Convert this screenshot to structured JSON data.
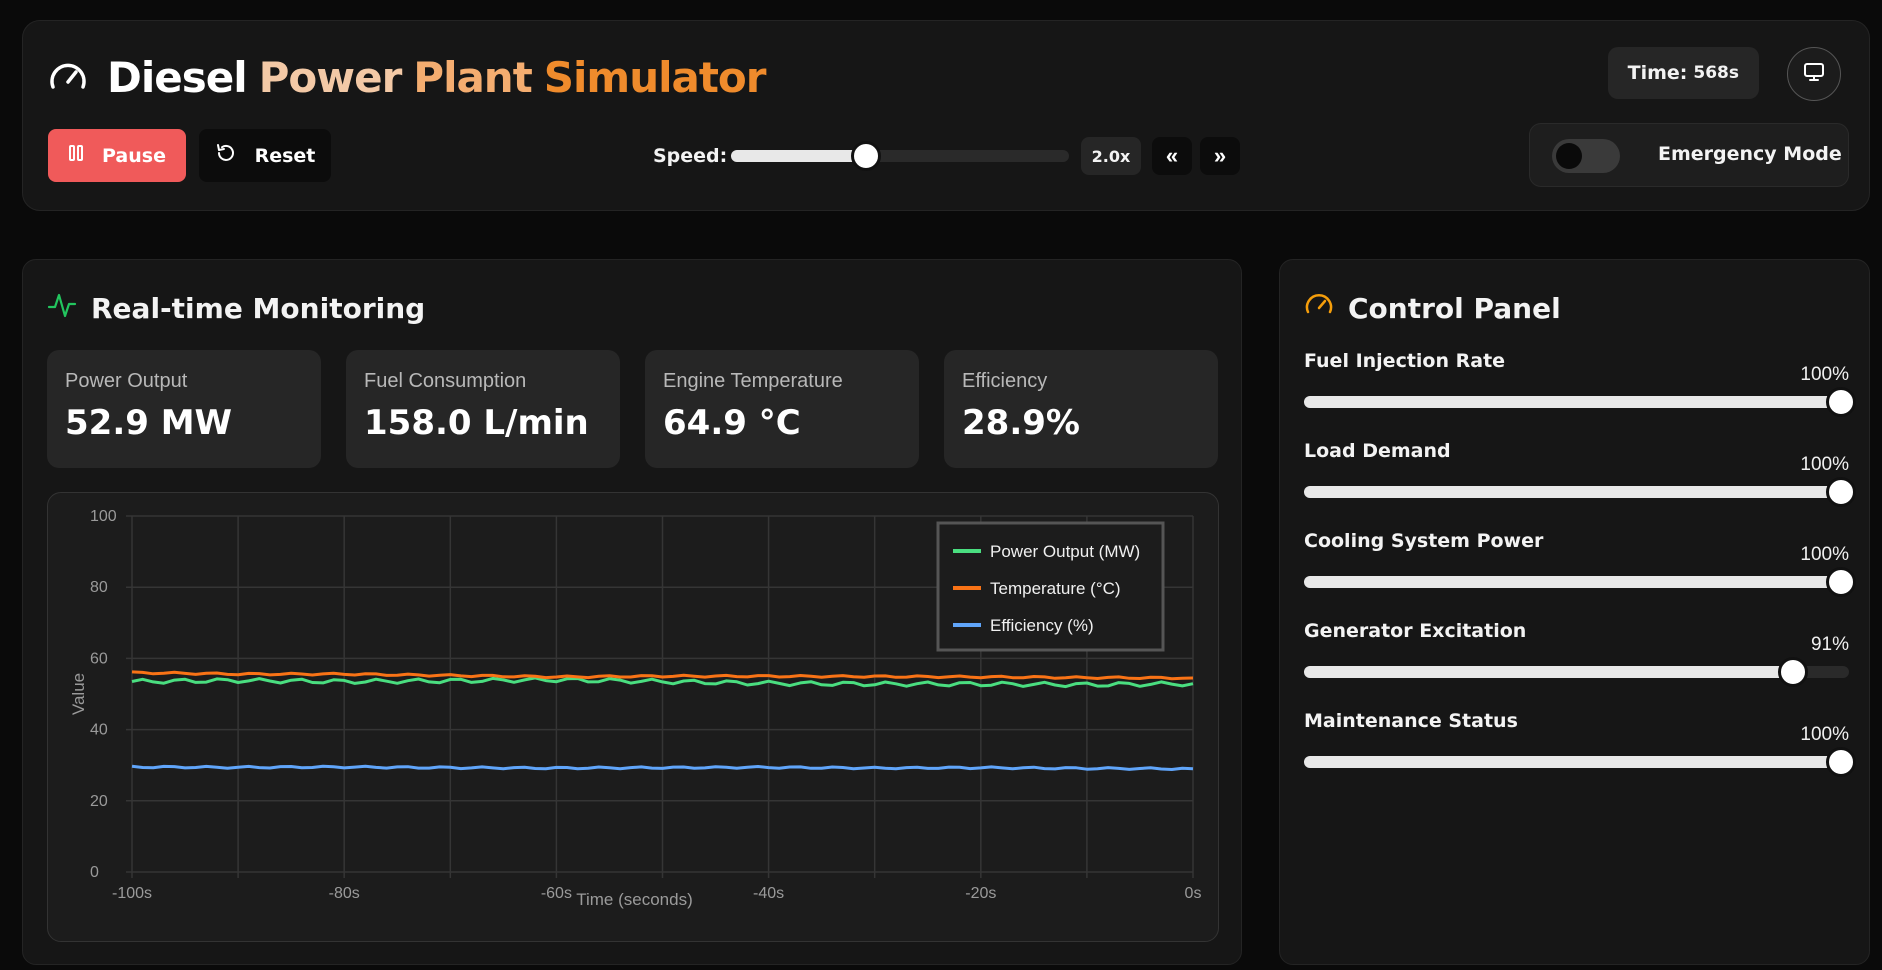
{
  "header": {
    "title_parts": [
      "Diesel",
      "Power",
      "Plant",
      "Simulator"
    ],
    "time_label": "Time:",
    "time_value": "568s",
    "pause_label": "Pause",
    "reset_label": "Reset",
    "speed_label": "Speed:",
    "speed_value": "2.0x",
    "speed_fraction": 0.4,
    "emergency_label": "Emergency Mode",
    "emergency_on": false
  },
  "monitoring": {
    "title": "Real-time Monitoring",
    "metrics": [
      {
        "label": "Power Output",
        "value": "52.9 MW"
      },
      {
        "label": "Fuel Consumption",
        "value": "158.0 L/min"
      },
      {
        "label": "Engine Temperature",
        "value": "64.9 °C"
      },
      {
        "label": "Efficiency",
        "value": "28.9%"
      }
    ]
  },
  "chart_data": {
    "type": "line",
    "xlabel": "Time (seconds)",
    "ylabel": "Value",
    "xlim": [
      -100,
      0
    ],
    "ylim": [
      0,
      100
    ],
    "x_ticks": [
      "-100s",
      "-80s",
      "-60s",
      "-40s",
      "-20s",
      "0s"
    ],
    "x_tick_values": [
      -100,
      -80,
      -60,
      -40,
      -20,
      0
    ],
    "y_ticks": [
      "0",
      "20",
      "40",
      "60",
      "80",
      "100"
    ],
    "y_tick_values": [
      0,
      20,
      40,
      60,
      80,
      100
    ],
    "grid": true,
    "legend_position": "top-right",
    "series": [
      {
        "name": "Power Output (MW)",
        "color": "#4ade80",
        "x": [
          -100,
          -90,
          -80,
          -70,
          -60,
          -50,
          -40,
          -30,
          -20,
          -10,
          0
        ],
        "values": [
          53.5,
          53.8,
          53.5,
          53.7,
          54.0,
          53.5,
          53.0,
          52.8,
          52.8,
          52.6,
          52.9
        ]
      },
      {
        "name": "Temperature (°C)",
        "color": "#f97316",
        "x": [
          -100,
          -90,
          -80,
          -70,
          -60,
          -50,
          -40,
          -30,
          -20,
          -10,
          0
        ],
        "values": [
          56.0,
          55.6,
          55.6,
          55.2,
          54.8,
          55.0,
          55.0,
          54.9,
          54.8,
          54.6,
          54.5
        ]
      },
      {
        "name": "Efficiency (%)",
        "color": "#60a5fa",
        "x": [
          -100,
          -90,
          -80,
          -70,
          -60,
          -50,
          -40,
          -30,
          -20,
          -10,
          0
        ],
        "values": [
          29.5,
          29.4,
          29.5,
          29.3,
          29.2,
          29.3,
          29.4,
          29.2,
          29.3,
          29.1,
          29.0
        ]
      }
    ]
  },
  "control_panel": {
    "title": "Control Panel",
    "controls": [
      {
        "label": "Fuel Injection Rate",
        "value": "100%",
        "fraction": 1.0
      },
      {
        "label": "Load Demand",
        "value": "100%",
        "fraction": 1.0
      },
      {
        "label": "Cooling System Power",
        "value": "100%",
        "fraction": 1.0
      },
      {
        "label": "Generator Excitation",
        "value": "91%",
        "fraction": 0.91
      },
      {
        "label": "Maintenance Status",
        "value": "100%",
        "fraction": 1.0
      }
    ]
  }
}
